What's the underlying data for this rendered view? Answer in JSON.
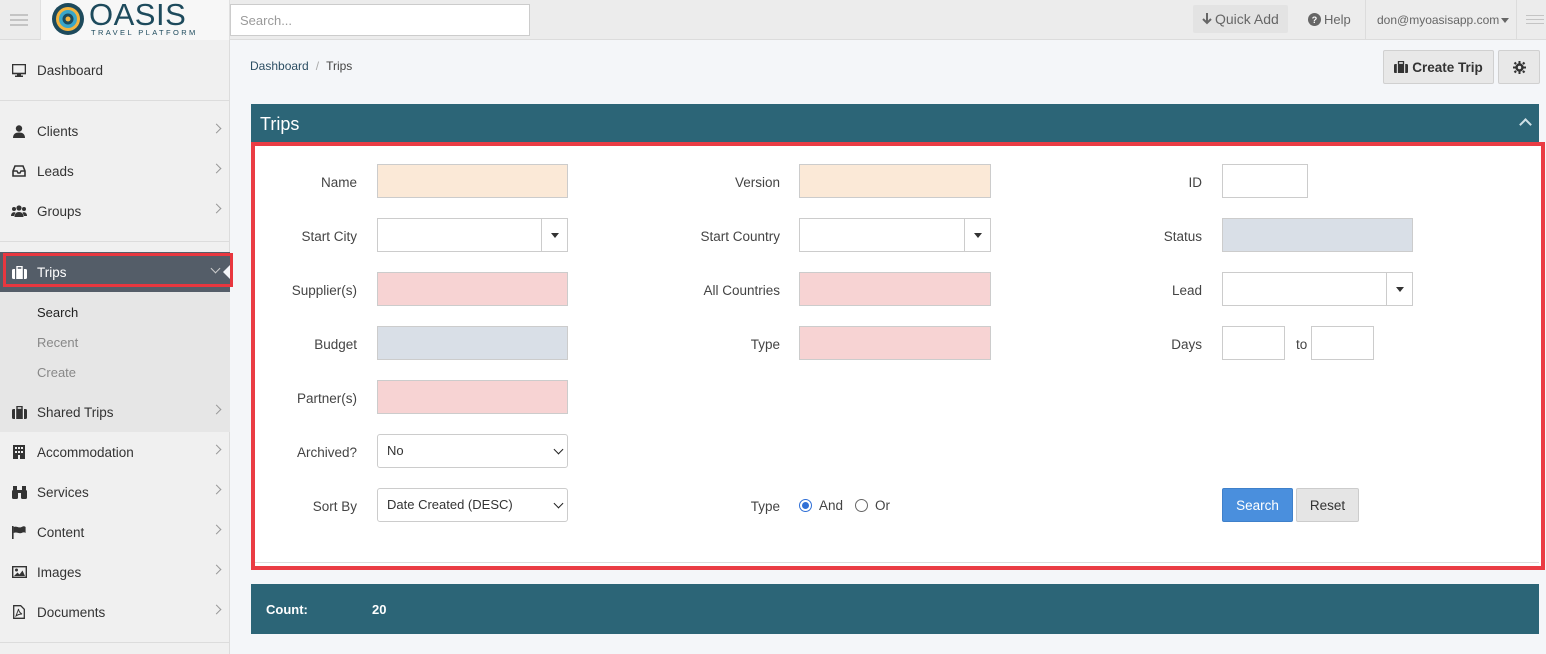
{
  "topbar": {
    "logo_text": "OASIS",
    "logo_sub": "TRAVEL PLATFORM",
    "search_placeholder": "Search...",
    "quick_add": "Quick Add",
    "help": "Help",
    "user_email": "don@myoasisapp.com"
  },
  "sidebar": {
    "dashboard": "Dashboard",
    "clients": "Clients",
    "leads": "Leads",
    "groups": "Groups",
    "trips": "Trips",
    "trips_sub": [
      "Search",
      "Recent",
      "Create"
    ],
    "shared_trips": "Shared Trips",
    "accommodation": "Accommodation",
    "services": "Services",
    "content": "Content",
    "images": "Images",
    "documents": "Documents"
  },
  "breadcrumb": [
    "Dashboard",
    "Trips"
  ],
  "header_buttons": {
    "create_trip": "Create Trip"
  },
  "panel": {
    "title": "Trips"
  },
  "form": {
    "labels": {
      "name": "Name",
      "version": "Version",
      "id": "ID",
      "start_city": "Start City",
      "start_country": "Start Country",
      "status": "Status",
      "suppliers": "Supplier(s)",
      "all_countries": "All Countries",
      "lead": "Lead",
      "budget": "Budget",
      "type": "Type",
      "days": "Days",
      "days_to": "to",
      "partners": "Partner(s)",
      "archived": "Archived?",
      "sort_by": "Sort By",
      "match_type": "Type"
    },
    "archived_value": "No",
    "sort_by_value": "Date Created (DESC)",
    "match_options": [
      "And",
      "Or"
    ],
    "match_selected": "And",
    "search_button": "Search",
    "reset_button": "Reset"
  },
  "results": {
    "count_label": "Count:",
    "count_value": "20"
  },
  "colors": {
    "teal": "#2c6577",
    "highlight": "#ea3c44",
    "primary": "#4a8fdd",
    "peach": "#fbe9d7",
    "pink": "#f7d3d3",
    "grey": "#d9dfe7"
  }
}
